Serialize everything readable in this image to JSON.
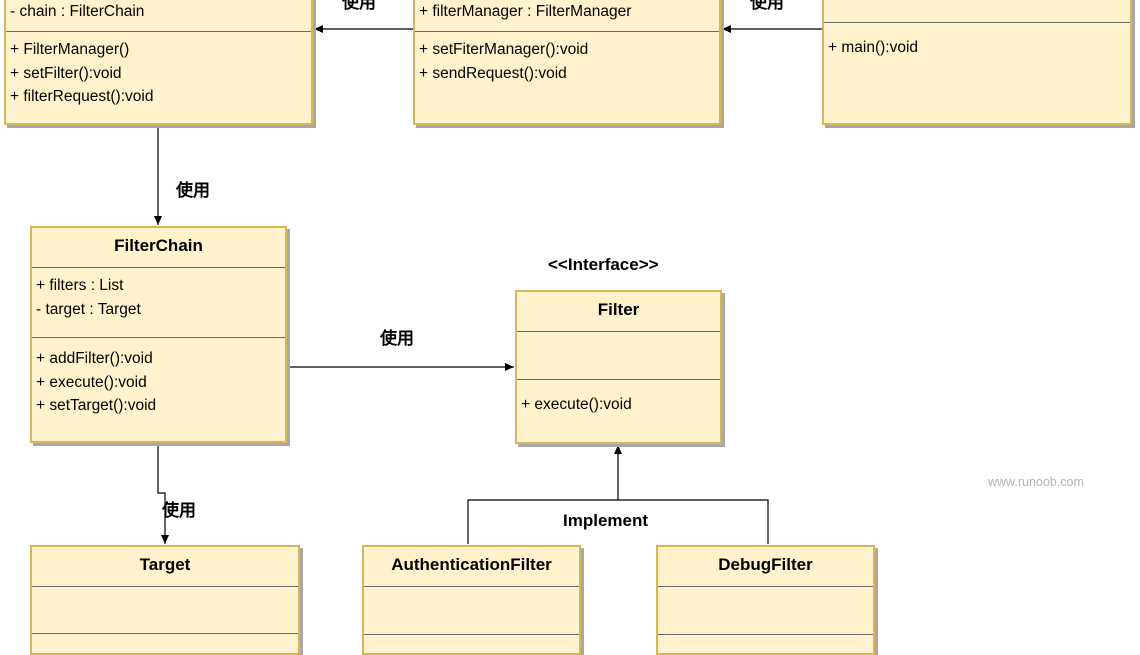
{
  "classes": {
    "filter_manager": {
      "attrs": [
        "- chain : FilterChain"
      ],
      "ops": [
        "+ FilterManager()",
        "+ setFilter():void",
        "+ filterRequest():void"
      ]
    },
    "client": {
      "attrs": [
        "+ filterManager : FilterManager"
      ],
      "ops": [
        "+ setFiterManager():void",
        "+ sendRequest():void"
      ]
    },
    "demo": {
      "ops": [
        "+ main():void"
      ]
    },
    "filter_chain": {
      "name": "FilterChain",
      "attrs": [
        "+ filters : List",
        "- target : Target"
      ],
      "ops": [
        "+ addFilter():void",
        "+ execute():void",
        "+ setTarget():void"
      ]
    },
    "filter": {
      "stereotype": "<<Interface>>",
      "name": "Filter",
      "attrs": [],
      "ops": [
        "+ execute():void"
      ]
    },
    "target": {
      "name": "Target"
    },
    "authentication_filter": {
      "name": "AuthenticationFilter"
    },
    "debug_filter": {
      "name": "DebugFilter"
    }
  },
  "relations": {
    "uses_label": "使用",
    "implement_label": "Implement"
  },
  "watermark": "www.runoob.com"
}
